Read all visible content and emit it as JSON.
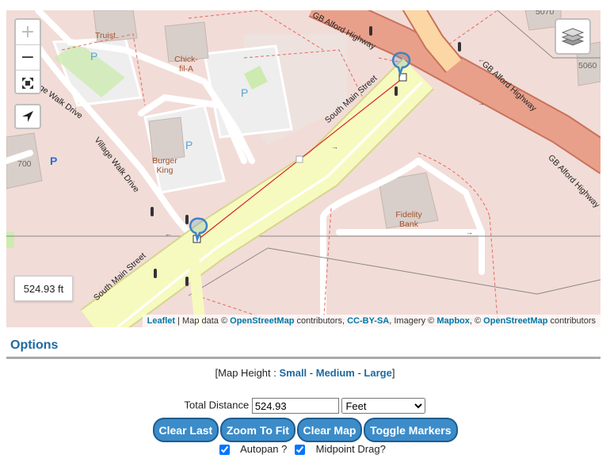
{
  "map": {
    "zoom_in": "+",
    "zoom_out": "−",
    "distance_label": "524.93 ft",
    "labels": {
      "trust": "Truist",
      "chickfila": "Chick-fil-A",
      "burger_king": "Burger King",
      "fidelity": "Fidelity Bank",
      "village_walk_1": "Village Walk Drive",
      "village_walk_2": "Village Walk Drive",
      "south_main_1": "South Main Street",
      "south_main_2": "South Main Street",
      "gb_alford_1": "GB Alford Highway",
      "gb_alford_2": "GB Alford Highway",
      "gb_alford_3": "GB Alford Highway",
      "num_700": "700",
      "num_5060": "5060",
      "num_5070": "5070",
      "parking": "P"
    },
    "attribution": {
      "leaflet": "Leaflet",
      "t1": " | Map data © ",
      "osm1": "OpenStreetMap",
      "t2": " contributors, ",
      "ccbysa": "CC-BY-SA",
      "t3": ", Imagery © ",
      "mapbox": "Mapbox",
      "t4": ", © ",
      "osm2": "OpenStreetMap",
      "t5": " contributors"
    },
    "colors": {
      "land": "#f2dcd7",
      "primary_road": "#f7fabf",
      "highway": "#e9a08a",
      "route": "#d62728"
    }
  },
  "options": {
    "title": "Options",
    "map_height_prefix": "[Map Height : ",
    "small": "Small",
    "sep1": " - ",
    "medium": "Medium",
    "sep2": " - ",
    "large": "Large",
    "suffix": "]",
    "total_distance_label": "Total Distance",
    "total_distance_value": "524.93",
    "unit_selected": "Feet",
    "buttons": {
      "clear_last": "Clear Last",
      "zoom_to_fit": "Zoom To Fit",
      "clear_map": "Clear Map",
      "toggle_markers": "Toggle Markers"
    },
    "autopan_label": "Autopan ?",
    "midpoint_label": "Midpoint Drag?",
    "autopan_checked": true,
    "midpoint_checked": true
  }
}
